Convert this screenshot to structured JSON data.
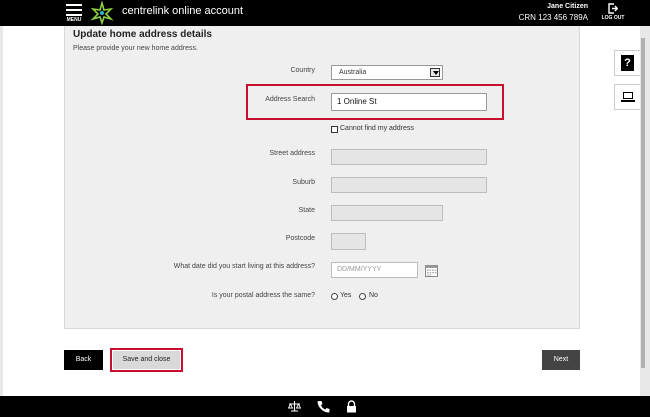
{
  "header": {
    "menu_label": "MENU",
    "app_title": "centrelink online account",
    "user_name": "Jane Citizen",
    "crn": "CRN 123 456 789A",
    "logout_label": "LOG OUT"
  },
  "side_tools": {
    "help_label": "?"
  },
  "form": {
    "title": "Update home address details",
    "subtitle": "Please provide your new home address.",
    "country": {
      "label": "Country",
      "value": "Australia"
    },
    "address_search": {
      "label": "Address Search",
      "value": "1 Online St"
    },
    "cannot_find": {
      "label": "Cannot find my address",
      "checked": false
    },
    "street_address": {
      "label": "Street address",
      "value": ""
    },
    "suburb": {
      "label": "Suburb",
      "value": ""
    },
    "state": {
      "label": "State",
      "value": ""
    },
    "postcode": {
      "label": "Postcode",
      "value": ""
    },
    "start_date": {
      "label": "What date did you start living at this address?",
      "placeholder": "DD/MM/YYYY"
    },
    "postal_same": {
      "label": "Is your postal address the same?",
      "yes": "Yes",
      "no": "No"
    }
  },
  "actions": {
    "back": "Back",
    "save_close": "Save and close",
    "next": "Next"
  },
  "colors": {
    "highlight": "#c8102e",
    "header_bg": "#000000",
    "panel_bg": "#efefef"
  },
  "footer_icons": [
    "scales-icon",
    "phone-icon",
    "lock-icon"
  ]
}
